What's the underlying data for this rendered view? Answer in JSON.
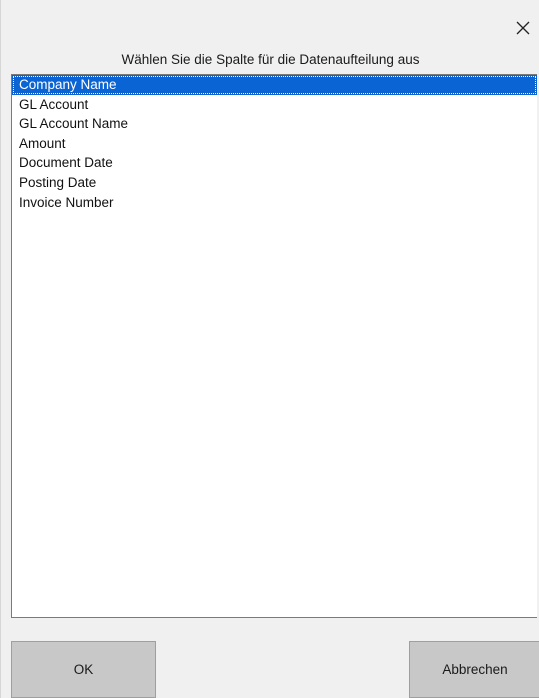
{
  "dialog": {
    "close_icon": "close-icon",
    "prompt": "Wählen Sie die Spalte für die Datenaufteilung aus"
  },
  "columns": {
    "selected_index": 0,
    "items": [
      "Company Name",
      "GL Account",
      "GL Account Name",
      "Amount",
      "Document Date",
      "Posting Date",
      "Invoice Number"
    ]
  },
  "buttons": {
    "ok_label": "OK",
    "cancel_label": "Abbrechen"
  },
  "colors": {
    "selection": "#0a64d4",
    "button_face": "#c8c8c8",
    "dialog_background": "#f0f0f0"
  }
}
